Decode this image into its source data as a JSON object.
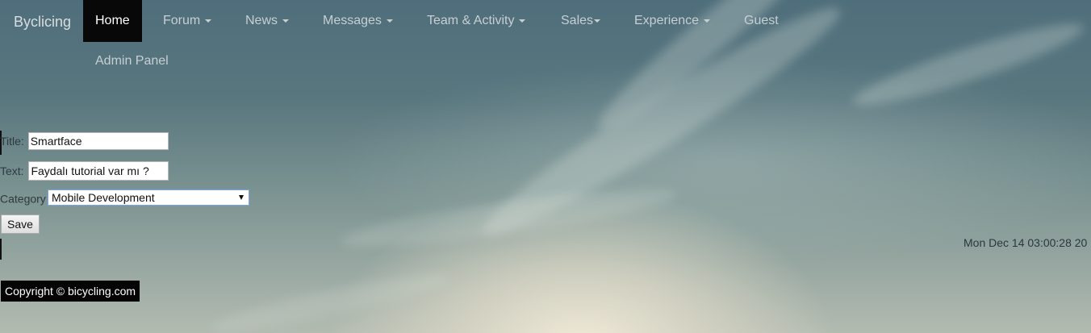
{
  "navbar": {
    "brand": "Byclicing",
    "items": [
      {
        "label": "Home",
        "active": true,
        "dropdown": false
      },
      {
        "label": "Forum",
        "active": false,
        "dropdown": true
      },
      {
        "label": "News",
        "active": false,
        "dropdown": true
      },
      {
        "label": "Messages",
        "active": false,
        "dropdown": true
      },
      {
        "label": "Team & Activity",
        "active": false,
        "dropdown": true
      },
      {
        "label": "Sales",
        "active": false,
        "dropdown": true
      },
      {
        "label": "Experience",
        "active": false,
        "dropdown": true
      },
      {
        "label": "Guest",
        "active": false,
        "dropdown": false
      }
    ],
    "second_row": "Admin Panel"
  },
  "form": {
    "title_label": "Title:",
    "title_value": "Smartface",
    "text_label": "Text:",
    "text_value": "Faydalı tutorial var mı ?",
    "category_label": "Category",
    "category_value": "Mobile Development",
    "save_label": "Save"
  },
  "timestamp": "Mon Dec 14 03:00:28 20",
  "footer": {
    "copyright": "Copyright © bicycling.com"
  },
  "colors": {
    "active_nav_bg": "#080808",
    "nav_text": "#c7cfd3",
    "footer_bg": "#050505",
    "select_border": "#7aa7e3"
  }
}
